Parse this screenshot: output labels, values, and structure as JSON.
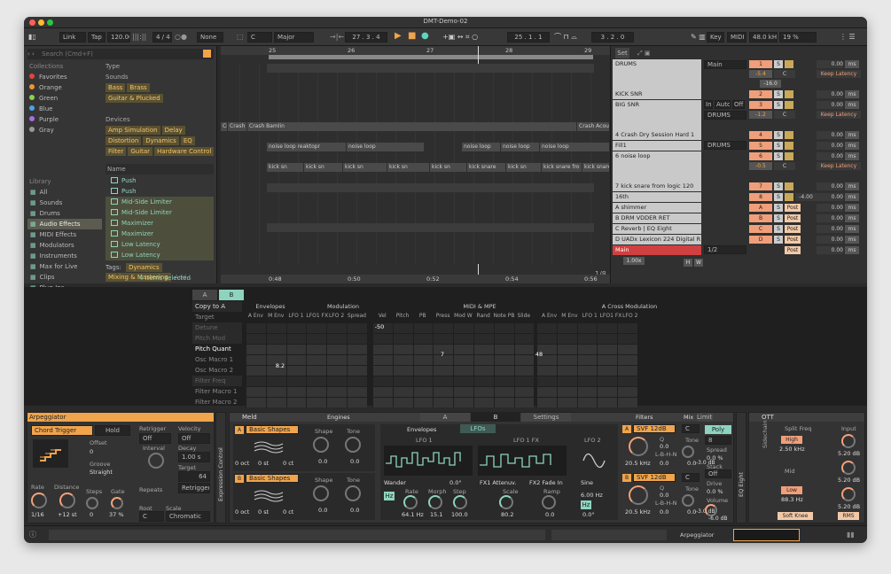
{
  "window": {
    "title": "DMT-Demo-02"
  },
  "control_bar": {
    "link": "Link",
    "tap": "Tap",
    "tempo": "120.00",
    "meter": "4 / 4",
    "record_none": "None",
    "key": "C",
    "scale": "Major",
    "position": "27 . 3 . 4",
    "loop_start": "25 . 1 . 1",
    "loop_length": "3 . 2 . 0",
    "key_btn": "Key",
    "midi_btn": "MIDI",
    "sample_rate": "48.0 kHz",
    "cpu": "19 %"
  },
  "browser": {
    "search_placeholder": "Search (Cmd+F)",
    "collections_header": "Collections",
    "collections": [
      {
        "label": "Favorites",
        "color": "#e0453f"
      },
      {
        "label": "Orange",
        "color": "#f29233"
      },
      {
        "label": "Green",
        "color": "#8fd14f"
      },
      {
        "label": "Blue",
        "color": "#4aa3e8"
      },
      {
        "label": "Purple",
        "color": "#a86fe0"
      },
      {
        "label": "Gray",
        "color": "#999999"
      }
    ],
    "library_header": "Library",
    "library": [
      "All",
      "Sounds",
      "Drums",
      "Audio Effects",
      "MIDI Effects",
      "Modulators",
      "Instruments",
      "Max for Live",
      "Clips",
      "Plug-Ins",
      "Samples"
    ],
    "type_header": "Type",
    "sounds_header": "Sounds",
    "sound_tags": [
      "Bass",
      "Brass",
      "Guitar & Plucked"
    ],
    "devices_header": "Devices",
    "device_tags": [
      "Amp Simulation",
      "Delay",
      "Distortion",
      "Dynamics",
      "EQ",
      "Filter",
      "Guitar",
      "Hardware Control"
    ],
    "name_header": "Name",
    "results": [
      "Push",
      "Push",
      "Mid-Side Limiter",
      "Mid-Side Limiter",
      "Maximizer",
      "Maximizer",
      "Low Latency",
      "Low Latency"
    ],
    "tags_label": "Tags:",
    "tags_value": "Dynamics",
    "tags_value2": "Mixing & Mastering",
    "tags_add": "Add...",
    "status": "4 items selected"
  },
  "arrangement": {
    "bars": [
      "25",
      "26",
      "27",
      "28",
      "29"
    ],
    "times": [
      "0:48",
      "0:50",
      "0:52",
      "0:54",
      "0:56"
    ],
    "clips_crash": [
      "Crash",
      "Crash",
      "Crash Bamlin",
      "Crash Acou"
    ],
    "clips_noise": [
      "noise loop reaktopr",
      "noise loop",
      "noise loop",
      "noise loop",
      "noise loop"
    ],
    "clips_kick": [
      "kick sn",
      "kick sn",
      "kick sn",
      "kick sn",
      "kick sn",
      "kick snare",
      "kick sn",
      "kick snare fro",
      "kick snare"
    ],
    "zoom": "1/8"
  },
  "mixer": {
    "set": "Set",
    "tracks": [
      {
        "name": "DRUMS",
        "num": "1"
      },
      {
        "name": "KICK SNR",
        "num": "2"
      },
      {
        "name": "BIG SNR",
        "num": "3"
      },
      {
        "name": "4 Crash Dry Session Hard 1",
        "num": "4"
      },
      {
        "name": "Fill1",
        "num": "5"
      },
      {
        "name": "6 noise loop",
        "num": "6"
      },
      {
        "name": "7 kick snare from logic 120",
        "num": "7"
      },
      {
        "name": "16th",
        "num": "8"
      }
    ],
    "returns": [
      {
        "name": "A shimmer",
        "num": "A"
      },
      {
        "name": "B DRM VDDER RET",
        "num": "B"
      },
      {
        "name": "C Reverb | EQ Eight",
        "num": "C"
      },
      {
        "name": "D UADx Lexicon 224 Digital R",
        "num": "D"
      }
    ],
    "main": "Main",
    "main_out": "1/2",
    "main_vol": "1.00x",
    "routing": [
      "Main",
      "DRUMS",
      "DRUMS"
    ],
    "in": "In",
    "auto": "Auto",
    "off": "Off",
    "pan_vals": [
      "-5.4",
      "-16.0",
      "-1.2",
      "-0.5"
    ],
    "pan_c": "C",
    "keep_latency": "Keep Latency",
    "ms_val": "0.00",
    "ms": "ms",
    "send_val": "-4.00",
    "s": "S",
    "post": "Post",
    "hw": [
      "H",
      "W"
    ]
  },
  "mod_matrix": {
    "ab": [
      "A",
      "B"
    ],
    "copy": "Copy to A",
    "target": "Target",
    "groups": [
      "Envelopes",
      "Modulation",
      "MIDI & MPE",
      "A Cross Modulation"
    ],
    "cols": [
      "A Env",
      "M Env",
      "LFO 1",
      "LFO1 FX",
      "LFO 2",
      "Spread",
      "Vel",
      "Pitch",
      "PB",
      "Press",
      "Mod W",
      "Rand",
      "Note PB",
      "Slide",
      "A Env",
      "M Env",
      "LFO 1",
      "LFO1 FX",
      "LFO 2"
    ],
    "rows": [
      "Detune",
      "Pitch Mod",
      "Pitch Quant",
      "Osc Macro 1",
      "Osc Macro 2",
      "Filter Freq",
      "Filter Macro 1",
      "Filter Macro 2"
    ],
    "vals": [
      "-50",
      "7",
      "48",
      "8.2"
    ]
  },
  "arp": {
    "title": "Arpeggiator",
    "mode": "Chord Trigger",
    "hold": "Hold",
    "offset_l": "Offset",
    "offset": "0",
    "groove_l": "Groove",
    "groove": "Straight",
    "retrig_l": "Retrigger",
    "retrig": "Off",
    "interval_l": "Interval",
    "vel_l": "Velocity",
    "vel": "Off",
    "decay_l": "Decay",
    "decay": "1.00 s",
    "target_l": "Target",
    "target": "64",
    "retrig_btn": "Retrigger",
    "repeats_l": "Repeats",
    "root_l": "Root",
    "root": "C",
    "scale_l": "Scale",
    "scale": "Chromatic",
    "rate_l": "Rate",
    "rate": "1/16",
    "dist_l": "Distance",
    "dist": "+12 st",
    "steps_l": "Steps",
    "steps": "0",
    "gate_l": "Gate",
    "gate": "37 %",
    "side": "Expression Control"
  },
  "meld": {
    "title": "Meld",
    "engines": "Engines",
    "a": "A",
    "b": "B",
    "settings": "Settings",
    "filters": "Filters",
    "mix": "Mix",
    "limit": "Limit",
    "osc": "Basic Shapes",
    "oct": "0 oct",
    "st": "0 st",
    "ct": "0 ct",
    "shape": "Shape",
    "tone": "Tone",
    "kv": "0.0",
    "envelopes": "Envelopes",
    "lfos": "LFOs",
    "lfo1": "LFO 1",
    "lfo1fx": "LFO 1 FX",
    "lfo2": "LFO 2",
    "wander": "Wander",
    "wander_v": "0.0°",
    "rate": "Rate",
    "rate_v": "64.1 Hz",
    "morph": "Morph",
    "morph_v": "15.1",
    "step": "Step",
    "step_v": "100.0",
    "fx1": "FX1 Attenuv.",
    "fx2": "FX2 Fade In",
    "scale": "Scale",
    "scale_v": "80.2",
    "ramp": "Ramp",
    "ramp_v": "0.0",
    "sine": "Sine",
    "sine_hz": "6.00 Hz",
    "sine_deg": "0.0°",
    "hz": "Hz",
    "svf": "SVF 12dB",
    "f_hz": "20.5 kHz",
    "res": "Q",
    "res_v": "0.0",
    "lbhn": "L-B-H-N",
    "pan": "C",
    "db": "-3.0 dB",
    "poly": "Poly",
    "voices": "8",
    "spread": "Spread",
    "spread_v": "0.0 %",
    "stack": "Stack",
    "stack_v": "Off",
    "drive": "Drive",
    "drive_v": "0.0 %",
    "volume": "Volume",
    "volume_v": "-6.0 dB"
  },
  "ott": {
    "title": "OTT",
    "split": "Split Freq",
    "input": "Input",
    "high": "High",
    "high_hz": "2.50 kHz",
    "mid": "Mid",
    "low": "Low",
    "low_hz": "88.3 Hz",
    "db": "5.20 dB",
    "soft": "Soft Knee",
    "rms": "RMS",
    "side": "EQ Eight",
    "sidechain": "Sidechain"
  },
  "status_bar": {
    "track": "Arpeggiator"
  }
}
